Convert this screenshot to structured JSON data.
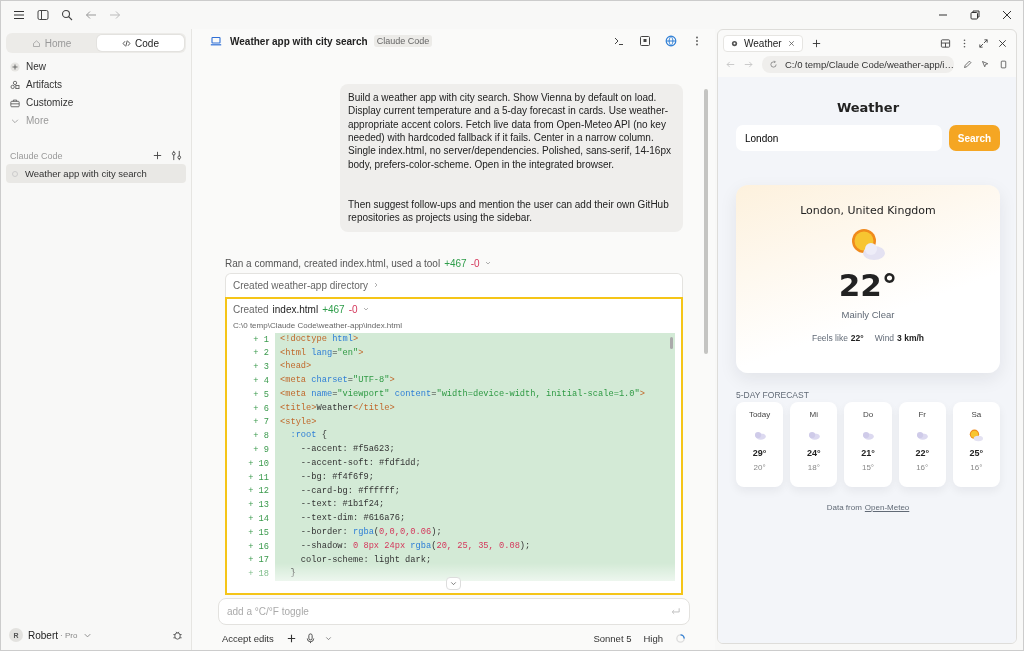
{
  "sidebar": {
    "tabs": [
      {
        "label": "Home",
        "selected": false
      },
      {
        "label": "Code",
        "selected": true
      }
    ],
    "items": [
      {
        "label": "New"
      },
      {
        "label": "Artifacts"
      },
      {
        "label": "Customize"
      },
      {
        "label": "More"
      }
    ],
    "section": "Claude Code",
    "sessions": [
      {
        "label": "Weather app with city search",
        "selected": true
      }
    ],
    "user": {
      "initial": "R",
      "name": "Robert",
      "plan": "· Pro"
    }
  },
  "chat": {
    "title": "Weather app with city search",
    "badge": "Claude Code",
    "message": [
      "Build a weather app with city search. Show Vienna by default on load. Display current temperature and a 5-day forecast in cards. Use weather-appropriate accent colors. Fetch live data from Open-Meteo API (no key needed) with hardcoded fallback if it fails. Center in a narrow column. Single index.html, no server/dependencies. Polished, sans-serif, 14-16px body, prefers-color-scheme. Open in the integrated browser.",
      "Then suggest follow-ups and mention the user can add their own GitHub repositories as projects using the sidebar."
    ],
    "summary": {
      "text": "Ran a command, created index.html, used a tool",
      "added": "+467",
      "removed": "-0"
    },
    "steps": [
      {
        "text": "Created weather-app directory",
        "expanded": false
      }
    ],
    "file": {
      "prefix": "Created",
      "name": "index.html",
      "added": "+467",
      "removed": "-0",
      "expanded": true,
      "path": "C:\\0 temp\\Claude Code\\weather-app\\index.html",
      "lines": [
        {
          "sign": "+",
          "number": "1",
          "segments": [
            {
              "kind": "tag",
              "text": "<!doctype "
            },
            {
              "kind": "attr",
              "text": "html"
            },
            {
              "kind": "tag",
              "text": ">"
            }
          ]
        },
        {
          "sign": "+",
          "number": "2",
          "segments": [
            {
              "kind": "tag",
              "text": "<html "
            },
            {
              "kind": "attr",
              "text": "lang"
            },
            {
              "kind": "plain",
              "text": "="
            },
            {
              "kind": "str",
              "text": "\"en\""
            },
            {
              "kind": "tag",
              "text": ">"
            }
          ]
        },
        {
          "sign": "+",
          "number": "3",
          "segments": [
            {
              "kind": "tag",
              "text": "<head>"
            }
          ]
        },
        {
          "sign": "+",
          "number": "4",
          "segments": [
            {
              "kind": "tag",
              "text": "<meta "
            },
            {
              "kind": "attr",
              "text": "charset"
            },
            {
              "kind": "plain",
              "text": "="
            },
            {
              "kind": "str",
              "text": "\"UTF-8\""
            },
            {
              "kind": "tag",
              "text": ">"
            }
          ]
        },
        {
          "sign": "+",
          "number": "5",
          "segments": [
            {
              "kind": "tag",
              "text": "<meta "
            },
            {
              "kind": "attr",
              "text": "name"
            },
            {
              "kind": "plain",
              "text": "="
            },
            {
              "kind": "str",
              "text": "\"viewport\""
            },
            {
              "kind": "attr",
              "text": " content"
            },
            {
              "kind": "plain",
              "text": "="
            },
            {
              "kind": "str",
              "text": "\"width=device-width, initial-scale=1.0\""
            },
            {
              "kind": "tag",
              "text": ">"
            }
          ]
        },
        {
          "sign": "+",
          "number": "6",
          "segments": [
            {
              "kind": "tag",
              "text": "<title>"
            },
            {
              "kind": "plain",
              "text": "Weather"
            },
            {
              "kind": "tag",
              "text": "</title>"
            }
          ]
        },
        {
          "sign": "+",
          "number": "7",
          "segments": [
            {
              "kind": "tag",
              "text": "<style>"
            }
          ]
        },
        {
          "sign": "+",
          "number": "8",
          "segments": [
            {
              "kind": "attr",
              "text": "  :root"
            },
            {
              "kind": "plain",
              "text": " {"
            }
          ]
        },
        {
          "sign": "+",
          "number": "9",
          "segments": [
            {
              "kind": "plain",
              "text": "    --accent: #f5a623;"
            }
          ]
        },
        {
          "sign": "+",
          "number": "10",
          "segments": [
            {
              "kind": "plain",
              "text": "    --accent-soft: #fdf1dd;"
            }
          ]
        },
        {
          "sign": "+",
          "number": "11",
          "segments": [
            {
              "kind": "plain",
              "text": "    --bg: #f4f6f9;"
            }
          ]
        },
        {
          "sign": "+",
          "number": "12",
          "segments": [
            {
              "kind": "plain",
              "text": "    --card-bg: #ffffff;"
            }
          ]
        },
        {
          "sign": "+",
          "number": "13",
          "segments": [
            {
              "kind": "plain",
              "text": "    --text: #1b1f24;"
            }
          ]
        },
        {
          "sign": "+",
          "number": "14",
          "segments": [
            {
              "kind": "plain",
              "text": "    --text-dim: #616a76;"
            }
          ]
        },
        {
          "sign": "+",
          "number": "15",
          "segments": [
            {
              "kind": "plain",
              "text": "    --border: "
            },
            {
              "kind": "attr",
              "text": "rgba"
            },
            {
              "kind": "plain",
              "text": "("
            },
            {
              "kind": "num",
              "text": "0,0,0,0.06"
            },
            {
              "kind": "plain",
              "text": ");"
            }
          ]
        },
        {
          "sign": "+",
          "number": "16",
          "segments": [
            {
              "kind": "plain",
              "text": "    --shadow: "
            },
            {
              "kind": "num",
              "text": "0 8px 24px "
            },
            {
              "kind": "attr",
              "text": "rgba"
            },
            {
              "kind": "plain",
              "text": "("
            },
            {
              "kind": "num",
              "text": "20, 25, 35, 0.08"
            },
            {
              "kind": "plain",
              "text": ");"
            }
          ]
        },
        {
          "sign": "+",
          "number": "17",
          "segments": [
            {
              "kind": "plain",
              "text": "    color-scheme: light dark;"
            }
          ]
        },
        {
          "sign": "+",
          "number": "18",
          "segments": [
            {
              "kind": "plain",
              "text": "  }"
            }
          ]
        }
      ]
    },
    "composer": {
      "placeholder": "add a °C/°F toggle",
      "mode": "Accept edits",
      "model": "Sonnet 5",
      "effort": "High"
    }
  },
  "browser": {
    "tab": "Weather",
    "url": "C:/0 temp/Claude Code/weather-app/i…",
    "page": {
      "title": "Weather",
      "search_value": "London",
      "search_button": "Search",
      "location": "London, United Kingdom",
      "kind": "partly-sunny",
      "temp": "22°",
      "condition": "Mainly Clear",
      "feels_label": "Feels like",
      "feels": "22°",
      "wind_label": "Wind",
      "wind": "3 km/h",
      "forecast_title": "5-DAY FORECAST",
      "days": [
        {
          "day": "Today",
          "kind": "cloudy",
          "high": "29°",
          "low": "20°"
        },
        {
          "day": "Mi",
          "kind": "cloudy",
          "high": "24°",
          "low": "18°"
        },
        {
          "day": "Do",
          "kind": "cloudy",
          "high": "21°",
          "low": "15°"
        },
        {
          "day": "Fr",
          "kind": "cloudy",
          "high": "22°",
          "low": "16°"
        },
        {
          "day": "Sa",
          "kind": "partly-sunny",
          "high": "25°",
          "low": "16°"
        }
      ],
      "footer": "Data from",
      "link": "Open-Meteo"
    }
  }
}
